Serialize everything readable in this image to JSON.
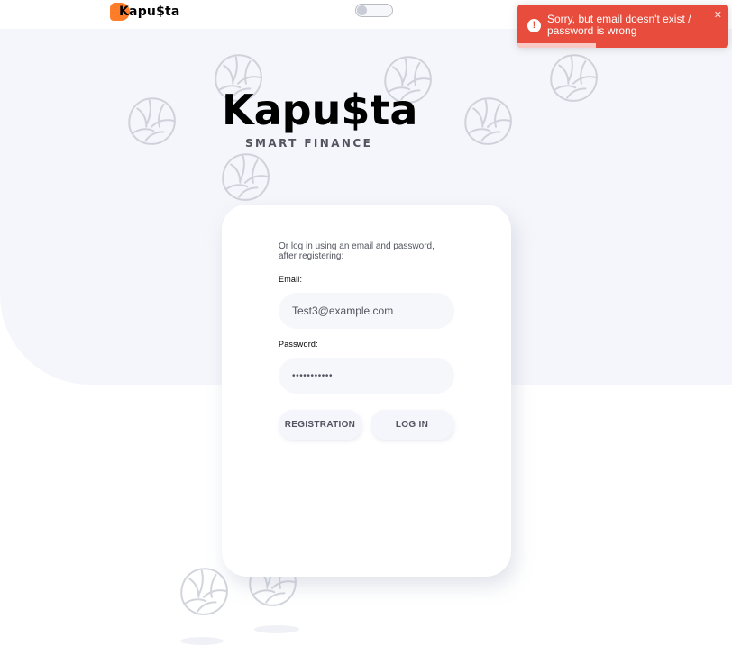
{
  "header": {
    "logo_text": "Kapu$ta",
    "theme_toggle_on": false
  },
  "hero": {
    "title": "Kapu$ta",
    "subtitle": "SMART FINANCE"
  },
  "login": {
    "intro": "Or log in using an email and password, after registering:",
    "email_label": "Email:",
    "email_value": "Test3@example.com",
    "password_label": "Password:",
    "password_value": "•••••••••••",
    "registration_label": "REGISTRATION",
    "login_label": "LOG IN"
  },
  "toast": {
    "message": "Sorry, but email doesn't exist / password is wrong",
    "icon": "!",
    "close": "✕",
    "progress": 0.37
  },
  "colors": {
    "accent": "#ff751d",
    "hero_bg": "#f5f6fb",
    "toast_bg": "#e74c3c",
    "text": "#52555f"
  },
  "icons": [
    "cabbage-icon",
    "alert-icon",
    "close-icon"
  ]
}
